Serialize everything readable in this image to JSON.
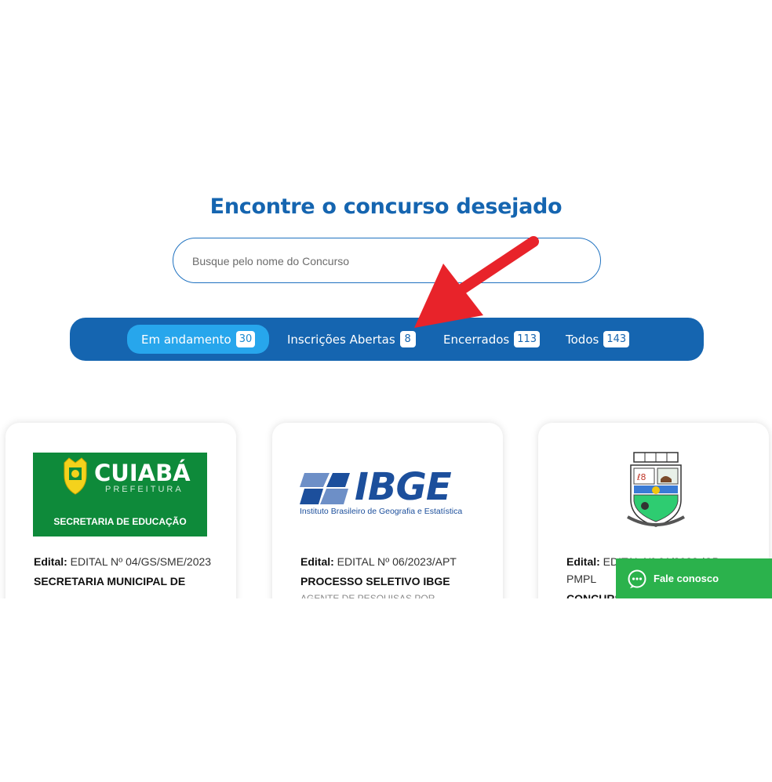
{
  "page": {
    "heading": "Encontre o concurso desejado"
  },
  "search": {
    "placeholder": "Busque pelo nome do Concurso"
  },
  "tabs": [
    {
      "label": "Em andamento",
      "count": "30",
      "active": true
    },
    {
      "label": "Inscrições Abertas",
      "count": "8"
    },
    {
      "label": "Encerrados",
      "count": "113"
    },
    {
      "label": "Todos",
      "count": "143"
    }
  ],
  "cards": [
    {
      "logo": {
        "name": "CUIABÁ",
        "subtitle": "PREFEITURA",
        "department": "SECRETARIA DE EDUCAÇÃO"
      },
      "edital_label": "Edital:",
      "edital_value": "EDITAL Nº 04/GS/SME/2023",
      "title": "SECRETARIA MUNICIPAL DE"
    },
    {
      "logo": {
        "name": "IBGE",
        "subtitle": "Instituto Brasileiro de Geografia e Estatística"
      },
      "edital_label": "Edital:",
      "edital_value": "EDITAL Nº 06/2023/APT",
      "title": "PROCESSO SELETIVO IBGE",
      "subtitle": "AGENTE DE PESQUISAS POR"
    },
    {
      "logo": {
        "name": "municipal-coat-of-arms"
      },
      "edital_label": "Edital:",
      "edital_value": "EDITAL Nº 01/2023 /CP-PMPL",
      "title": "CONCURSO"
    }
  ],
  "chat": {
    "label": "Fale conosco"
  },
  "colors": {
    "primary": "#1565b0",
    "active_tab": "#27a6ec",
    "chat": "#2bb24c",
    "annotation_arrow": "#e8232a"
  }
}
